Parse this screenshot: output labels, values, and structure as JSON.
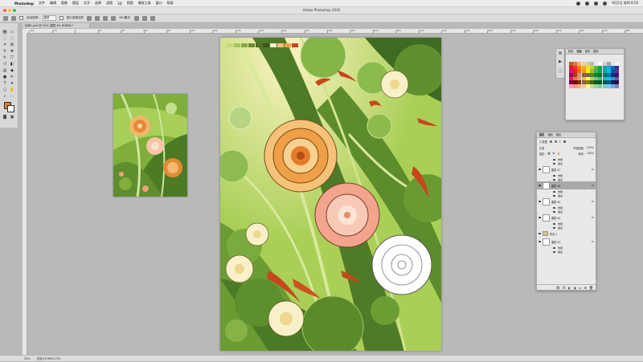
{
  "macos": {
    "app_name": "Photoshop",
    "menus": [
      "文件",
      "编辑",
      "图像",
      "图层",
      "文字",
      "选择",
      "滤镜",
      "3D",
      "视图",
      "增效工具",
      "窗口",
      "帮助"
    ],
    "clock": "9月2日 周四 8:56"
  },
  "window": {
    "title": "Adobe Photoshop 2020"
  },
  "options": {
    "auto_select_label": "自动选择:",
    "auto_select_value": "图层",
    "transform_label": "显示变换控件",
    "mode_label": "3D 模式:"
  },
  "document": {
    "tab": "玩转1.psd @ 25% (图层 46, RGB/8) *"
  },
  "ruler": {
    "labels": [
      "-400",
      "-200",
      "0",
      "200",
      "400",
      "600",
      "800",
      "1000",
      "1200",
      "1400",
      "1600",
      "1800",
      "2000",
      "2200",
      "2400",
      "2600",
      "2800",
      "3000",
      "3200",
      "3400",
      "3600",
      "3800",
      "4000",
      "4200",
      "4400",
      "4600",
      "4800"
    ]
  },
  "status": {
    "zoom": "25%",
    "doc_info": "文档:43.9M/1.07G"
  },
  "swatches_panel": {
    "tabs": [
      "颜色",
      "色板",
      "渐变",
      "图案"
    ],
    "colors": [
      "#c05a2a",
      "#e07a2e",
      "#f2b071",
      "#e9d3a6",
      "#d9c7a4",
      "#b9b9b9",
      "#eaeaea",
      "#ffffff",
      "#cfcfcf",
      "#a4a4a4",
      "#e5e5e5",
      "#f4f4f4",
      "#e11a22",
      "#ee3424",
      "#f47b20",
      "#f8a51c",
      "#f5e11c",
      "#bed730",
      "#5db848",
      "#00a651",
      "#00a99d",
      "#00aeef",
      "#0072bc",
      "#2e3192",
      "#ec008c",
      "#ed1c24",
      "#f26522",
      "#f7941d",
      "#fff200",
      "#8dc63f",
      "#39b54a",
      "#00a651",
      "#00a99d",
      "#00bff3",
      "#0054a6",
      "#662d91",
      "#9e005d",
      "#a0410d",
      "#c69c6d",
      "#8c6239",
      "#736357",
      "#598527",
      "#197b30",
      "#007236",
      "#00746b",
      "#0076a3",
      "#003471",
      "#440e62",
      "#ed145b",
      "#f26c4f",
      "#f69679",
      "#fbaf5d",
      "#fff568",
      "#acd373",
      "#7cc576",
      "#3bb878",
      "#1abbb4",
      "#00bff3",
      "#448ccb",
      "#605ca8",
      "#7b0046",
      "#790000",
      "#7d2f00",
      "#8c6239",
      "#827b00",
      "#406618",
      "#005e20",
      "#005826",
      "#005952",
      "#005b7f",
      "#002157",
      "#32004b",
      "#f49ac1",
      "#f7977a",
      "#f9ad81",
      "#fdc68a",
      "#fff79a",
      "#c4df9b",
      "#a3d39c",
      "#82ca9c",
      "#7accc8",
      "#6dcff6",
      "#7da7d9",
      "#8781bd"
    ]
  },
  "layers_panel": {
    "tabs": [
      "图层",
      "通道",
      "路径"
    ],
    "kind_label": "Q 类型",
    "blend_mode": "正常",
    "opacity_label": "不透明度:",
    "opacity_value": "100%",
    "lock_label": "锁定:",
    "fill_label": "填充:",
    "fill_value": "100%",
    "rows": [
      {
        "type": "sub",
        "text": "效果"
      },
      {
        "type": "sub",
        "text": "描边"
      },
      {
        "type": "layer",
        "name": "图层 47",
        "selected": false
      },
      {
        "type": "sub",
        "text": "效果"
      },
      {
        "type": "sub",
        "text": "描边"
      },
      {
        "type": "layer",
        "name": "图层 46",
        "selected": true
      },
      {
        "type": "sub",
        "text": "效果"
      },
      {
        "type": "sub",
        "text": "描边"
      },
      {
        "type": "layer",
        "name": "图层 45",
        "selected": false
      },
      {
        "type": "sub",
        "text": "效果"
      },
      {
        "type": "sub",
        "text": "描边"
      },
      {
        "type": "layer",
        "name": "图层 44",
        "selected": false
      },
      {
        "type": "sub",
        "text": "效果"
      },
      {
        "type": "sub",
        "text": "描边"
      },
      {
        "type": "group",
        "name": "形状 1",
        "selected": false
      },
      {
        "type": "layer",
        "name": "图层 43",
        "selected": false
      },
      {
        "type": "sub",
        "text": "效果"
      },
      {
        "type": "sub",
        "text": "描边"
      }
    ]
  }
}
